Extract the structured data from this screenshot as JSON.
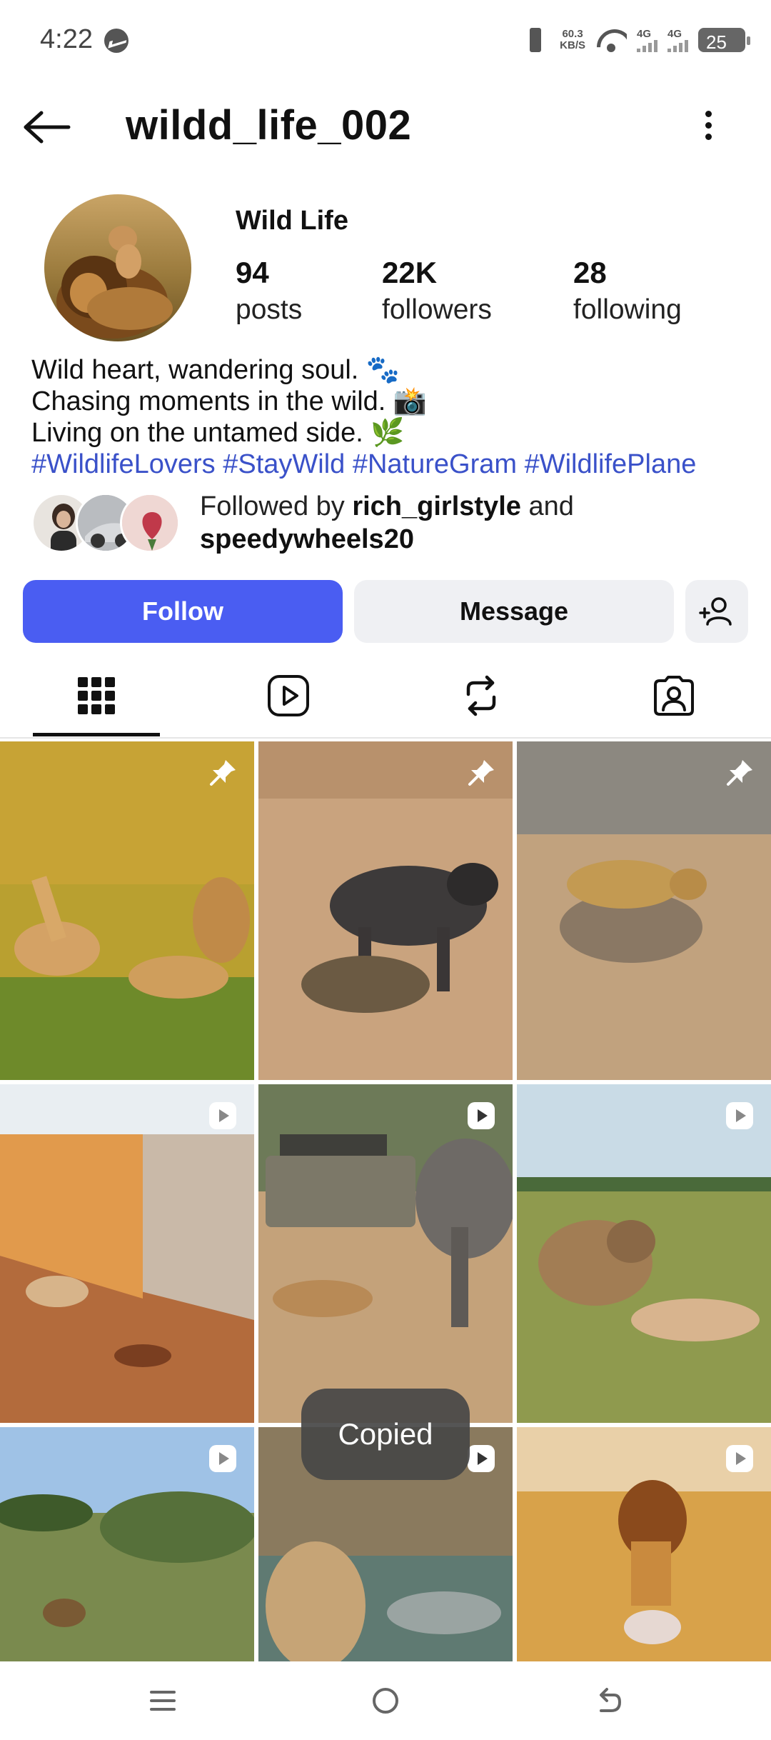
{
  "status_bar": {
    "time": "4:22",
    "net_speed_value": "60.3",
    "net_speed_unit": "KB/S",
    "sim1": "4G",
    "sim2": "4G",
    "battery": "25"
  },
  "header": {
    "username": "wildd_life_002"
  },
  "profile": {
    "display_name": "Wild Life",
    "stats": [
      {
        "value": "94",
        "label": "posts"
      },
      {
        "value": "22K",
        "label": "followers"
      },
      {
        "value": "28",
        "label": "following"
      }
    ],
    "bio": {
      "line1": "Wild heart, wandering soul. 🐾",
      "line2": "Chasing moments in the wild. 📸",
      "line3": "Living on the untamed side. 🌿",
      "hashtags": "#WildlifeLovers #StayWild #NatureGram #WildlifePlane"
    },
    "followed_by": {
      "prefix": "Followed by ",
      "user1": "rich_girlstyle",
      "joiner": " and",
      "user2": "speedywheels20"
    }
  },
  "actions": {
    "follow": "Follow",
    "message": "Message"
  },
  "tabs": [
    {
      "icon": "grid-icon",
      "active": true
    },
    {
      "icon": "reels-icon",
      "active": false
    },
    {
      "icon": "reposts-icon",
      "active": false
    },
    {
      "icon": "tagged-icon",
      "active": false
    }
  ],
  "grid": [
    {
      "subject": "antelopes on grass",
      "badge": "pin-icon"
    },
    {
      "subject": "wildebeest and hyena",
      "badge": "pin-icon"
    },
    {
      "subject": "leopard on warthog",
      "badge": "pin-icon"
    },
    {
      "subject": "dog by wall",
      "badge": "reel-icon"
    },
    {
      "subject": "elephant and safari jeep",
      "badge": "reel-icon"
    },
    {
      "subject": "hyena with prey",
      "badge": "reel-icon"
    },
    {
      "subject": "savanna with lions",
      "badge": "reel-icon"
    },
    {
      "subject": "lioness and crocodile",
      "badge": "reel-icon"
    },
    {
      "subject": "lion walking",
      "badge": "reel-icon"
    }
  ],
  "toast": "Copied",
  "colors": {
    "accent": "#4a5df2",
    "hashtag": "#3a51c9",
    "button_gray": "#eff0f3"
  }
}
